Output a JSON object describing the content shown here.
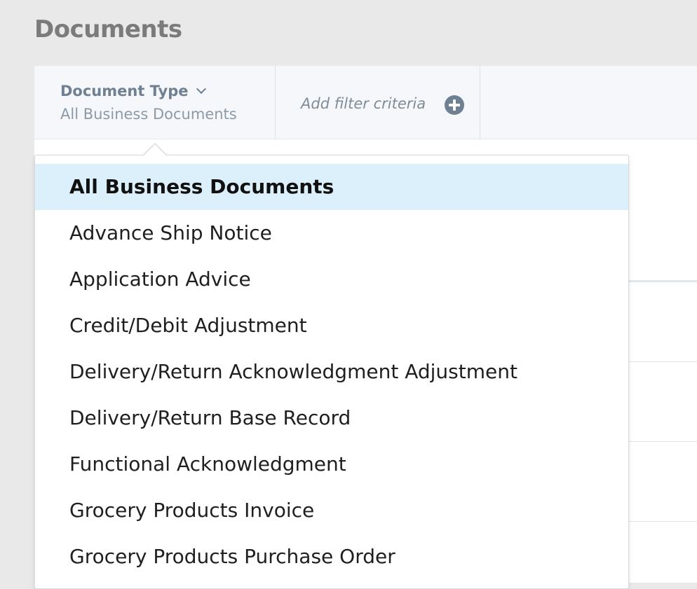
{
  "page": {
    "title": "Documents"
  },
  "filter_bar": {
    "document_type": {
      "label": "Document Type",
      "value": "All Business Documents"
    },
    "add_filter": {
      "label": "Add filter criteria"
    }
  },
  "dropdown": {
    "selected": "All Business Documents",
    "items": [
      {
        "label": "All Business Documents",
        "selected": true
      },
      {
        "label": "Advance Ship Notice",
        "selected": false
      },
      {
        "label": "Application Advice",
        "selected": false
      },
      {
        "label": "Credit/Debit Adjustment",
        "selected": false
      },
      {
        "label": "Delivery/Return Acknowledgment Adjustment",
        "selected": false
      },
      {
        "label": "Delivery/Return Base Record",
        "selected": false
      },
      {
        "label": "Functional Acknowledgment",
        "selected": false
      },
      {
        "label": "Grocery Products Invoice",
        "selected": false
      },
      {
        "label": "Grocery Products Purchase Order",
        "selected": false
      }
    ]
  },
  "colors": {
    "selected_item_bg": "#dcf0fb",
    "filter_label": "#6f8092",
    "page_bg": "#e9e9e9"
  },
  "icons": {
    "dropdown_toggle": "chevron-down-icon",
    "add_filter": "plus-circle-icon"
  }
}
